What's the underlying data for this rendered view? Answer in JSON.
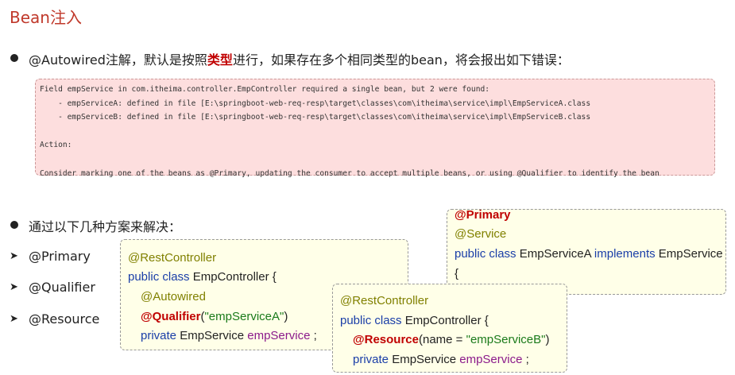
{
  "title": "Bean注入",
  "bullet1": {
    "prefix": "@Autowired注解，默认是按照",
    "highlight": "类型",
    "suffix": "进行，如果存在多个相同类型的bean，将会报出如下错误："
  },
  "error_lines": [
    "Field empService in com.itheima.controller.EmpController required a single bean, but 2 were found:",
    "    - empServiceA: defined in file [E:\\springboot-web-req-resp\\target\\classes\\com\\itheima\\service\\impl\\EmpServiceA.class",
    "    - empServiceB: defined in file [E:\\springboot-web-req-resp\\target\\classes\\com\\itheima\\service\\impl\\EmpServiceB.class",
    "",
    "Action:",
    "",
    "Consider marking one of the beans as @Primary, updating the consumer to accept multiple beans, or using @Qualifier to identify the bean"
  ],
  "bullet2": "通过以下几种方案来解决：",
  "solutions": [
    "@Primary",
    "@Qualifier",
    "@Resource"
  ],
  "code_primary": {
    "primary": "@Primary",
    "service": "@Service",
    "kw1": "public class",
    "name": " EmpServiceA ",
    "kw2": "implements",
    "iface": " EmpService",
    "brace": "{"
  },
  "code_qualifier": {
    "anno": "@RestController",
    "kw": "public class",
    "cls": " EmpController {",
    "autowired": "@Autowired",
    "qualifier": "@Qualifier",
    "paren_open": "(",
    "arg": "\"empServiceA\"",
    "paren_close": ")",
    "private": "private",
    "type": " EmpService ",
    "var": "empService",
    "end": " ;"
  },
  "code_resource": {
    "anno": "@RestController",
    "kw": "public class",
    "cls": " EmpController {",
    "resource": "@Resource",
    "args_pre": "(name = ",
    "arg": "\"empServiceB\"",
    "args_post": ")",
    "private": "private",
    "type": " EmpService ",
    "var": "empService",
    "end": " ;"
  }
}
